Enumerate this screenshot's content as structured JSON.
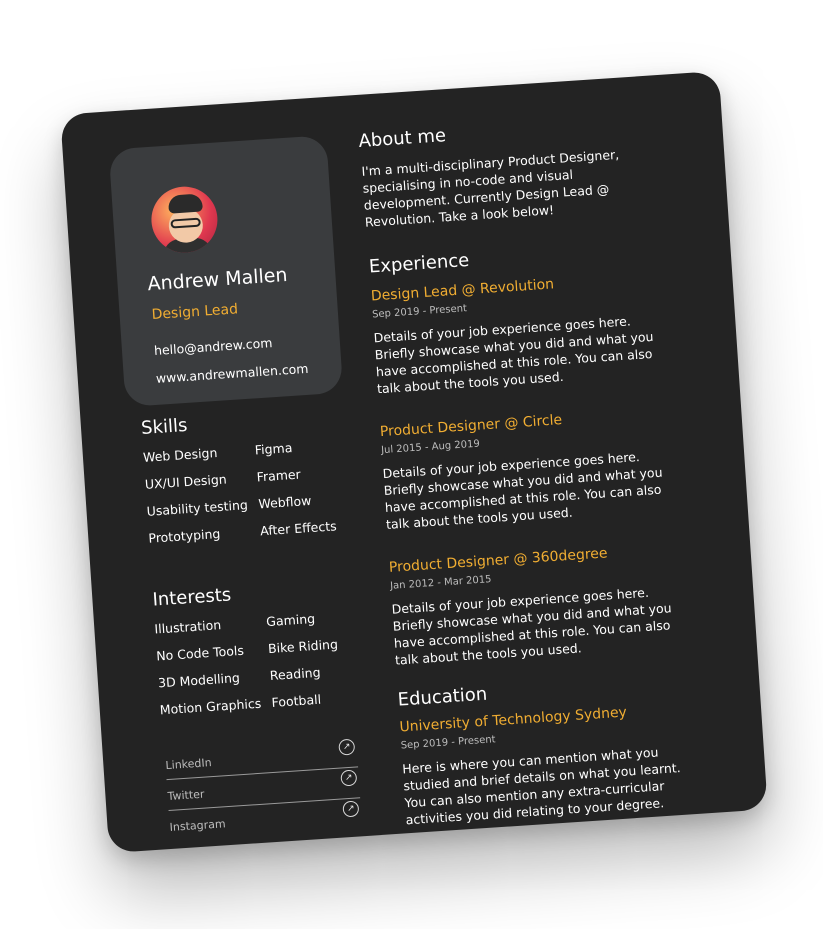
{
  "profile": {
    "name": "Andrew Mallen",
    "role": "Design Lead",
    "email": "hello@andrew.com",
    "website": "www.andrewmallen.com",
    "avatar_icon": "memoji-avatar"
  },
  "skills": {
    "title": "Skills",
    "items": [
      "Web Design",
      "Figma",
      "UX/UI Design",
      "Framer",
      "Usability testing",
      "Webflow",
      "Prototyping",
      "After Effects"
    ]
  },
  "interests": {
    "title": "Interests",
    "items": [
      "Illustration",
      "Gaming",
      "No Code Tools",
      "Bike Riding",
      "3D Modelling",
      "Reading",
      "Motion Graphics",
      "Football"
    ]
  },
  "social": [
    {
      "label": "LinkedIn",
      "icon": "external-link-icon"
    },
    {
      "label": "Twitter",
      "icon": "external-link-icon"
    },
    {
      "label": "Instagram",
      "icon": "external-link-icon"
    }
  ],
  "about": {
    "title": "About me",
    "text": "I'm a multi-disciplinary Product Designer, specialising in no-code and visual development. Currently Design Lead @ Revolution. Take a look below!"
  },
  "experience": {
    "title": "Experience",
    "jobs": [
      {
        "title": "Design Lead @ Revolution",
        "dates": "Sep 2019  -  Present",
        "details": "Details of your job experience goes here. Briefly showcase what you did and what you have accomplished at this role. You can also talk about the tools you used."
      },
      {
        "title": "Product Designer @ Circle",
        "dates": "Jul 2015  -  Aug 2019",
        "details": "Details of your job experience goes here. Briefly showcase what you did and what you have accomplished at this role. You can also talk about the tools you used."
      },
      {
        "title": "Product Designer @ 360degree",
        "dates": "Jan 2012  -  Mar 2015",
        "details": "Details of your job experience goes here. Briefly showcase what you did and what you have accomplished at this role. You can also talk about the tools you used."
      }
    ]
  },
  "education": {
    "title": "Education",
    "school": "University of Technology Sydney",
    "dates": "Sep 2019  -  Present",
    "details": "Here is where you can mention what you studied and brief details on what you learnt. You can also mention any extra-curricular activities you did relating to your degree."
  },
  "colors": {
    "accent": "#f0ad32",
    "card_bg": "#232323",
    "panel_bg": "#3a3c3e"
  }
}
